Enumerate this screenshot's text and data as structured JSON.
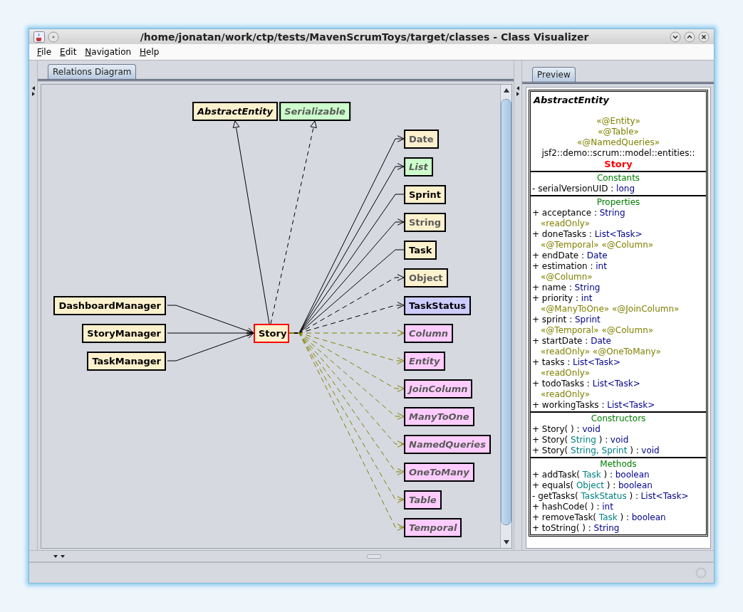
{
  "window": {
    "title": "/home/jonatan/work/ctp/tests/MavenScrumToys/target/classes - Class Visualizer"
  },
  "menu": [
    "File",
    "Edit",
    "Navigation",
    "Help"
  ],
  "diagram_tabs": [
    {
      "label": "Relations Diagram",
      "selected": true
    }
  ],
  "preview_tabs": [
    {
      "label": "Preview",
      "selected": true
    }
  ],
  "diagram": {
    "center": {
      "name": "Story",
      "kind": "class",
      "selected": true,
      "external": false
    },
    "supertypes": [
      {
        "name": "AbstractEntity",
        "kind": "abstract",
        "external": false,
        "edge": {
          "kind": "extends"
        }
      },
      {
        "name": "Serializable",
        "kind": "interface",
        "external": true,
        "edge": {
          "kind": "implements"
        }
      }
    ],
    "callers": [
      {
        "name": "DashboardManager",
        "kind": "class",
        "external": false,
        "edge": {
          "kind": "navigable"
        }
      },
      {
        "name": "StoryManager",
        "kind": "class",
        "external": false,
        "edge": {
          "kind": "navigable"
        }
      },
      {
        "name": "TaskManager",
        "kind": "class",
        "external": false,
        "edge": {
          "kind": "navigable"
        }
      }
    ],
    "dependencies": [
      {
        "name": "Date",
        "kind": "class",
        "external": true,
        "edge": {
          "kind": "navigable"
        }
      },
      {
        "name": "List",
        "kind": "interface",
        "external": true,
        "edge": {
          "kind": "navigable"
        }
      },
      {
        "name": "Sprint",
        "kind": "class",
        "external": false,
        "edge": {
          "kind": "association"
        }
      },
      {
        "name": "String",
        "kind": "class",
        "external": true,
        "edge": {
          "kind": "navigable"
        }
      },
      {
        "name": "Task",
        "kind": "class",
        "external": false,
        "edge": {
          "kind": "association"
        }
      },
      {
        "name": "Object",
        "kind": "class",
        "external": true,
        "edge": {
          "kind": "dependency"
        }
      },
      {
        "name": "TaskStatus",
        "kind": "enum",
        "external": false,
        "edge": {
          "kind": "dependency"
        }
      },
      {
        "name": "Column",
        "kind": "annotation",
        "external": true,
        "edge": {
          "kind": "annotation"
        }
      },
      {
        "name": "Entity",
        "kind": "annotation",
        "external": true,
        "edge": {
          "kind": "annotation"
        }
      },
      {
        "name": "JoinColumn",
        "kind": "annotation",
        "external": true,
        "edge": {
          "kind": "annotation"
        }
      },
      {
        "name": "ManyToOne",
        "kind": "annotation",
        "external": true,
        "edge": {
          "kind": "annotation"
        }
      },
      {
        "name": "NamedQueries",
        "kind": "annotation",
        "external": true,
        "edge": {
          "kind": "annotation"
        }
      },
      {
        "name": "OneToMany",
        "kind": "annotation",
        "external": true,
        "edge": {
          "kind": "annotation"
        }
      },
      {
        "name": "Table",
        "kind": "annotation",
        "external": true,
        "edge": {
          "kind": "annotation"
        }
      },
      {
        "name": "Temporal",
        "kind": "annotation",
        "external": true,
        "edge": {
          "kind": "annotation"
        }
      }
    ]
  },
  "preview": {
    "superclass": "AbstractEntity",
    "stereotypes": [
      "«@Entity»",
      "«@Table»",
      "«@NamedQueries»"
    ],
    "package": "jsf2::demo::scrum::model::entities::",
    "class_name": "Story",
    "constants_title": "Constants",
    "constants": [
      {
        "signature": "- serialVersionUID :",
        "type": "long"
      }
    ],
    "properties_title": "Properties",
    "properties": [
      {
        "signature": "+ acceptance :",
        "type": "String",
        "annotations": "«readOnly»"
      },
      {
        "signature": "+ doneTasks :",
        "type": "List<Task>",
        "annotations": "«@Temporal» «@Column»"
      },
      {
        "signature": "+ endDate :",
        "type": "Date"
      },
      {
        "signature": "+ estimation :",
        "type": "int",
        "annotations": "«@Column»"
      },
      {
        "signature": "+ name :",
        "type": "String"
      },
      {
        "signature": "+ priority :",
        "type": "int",
        "annotations": "«@ManyToOne» «@JoinColumn»"
      },
      {
        "signature": "+ sprint :",
        "type": "Sprint",
        "annotations": "«@Temporal» «@Column»"
      },
      {
        "signature": "+ startDate :",
        "type": "Date",
        "annotations": "«readOnly» «@OneToMany»"
      },
      {
        "signature": "+ tasks :",
        "type": "List<Task>",
        "annotations": "«readOnly»"
      },
      {
        "signature": "+ todoTasks :",
        "type": "List<Task>",
        "annotations": "«readOnly»"
      },
      {
        "signature": "+ workingTasks :",
        "type": "List<Task>"
      }
    ],
    "constructors_title": "Constructors",
    "constructors": [
      {
        "signature": "+ Story( ) :",
        "type": "void"
      },
      {
        "signature": "+ Story(",
        "params": "String",
        "tail": ") :",
        "type": "void"
      },
      {
        "signature": "+ Story(",
        "params": "String, Sprint",
        "tail": ") :",
        "type": "void"
      }
    ],
    "methods_title": "Methods",
    "methods": [
      {
        "signature": "+ addTask(",
        "params": "Task",
        "tail": ") :",
        "type": "boolean"
      },
      {
        "signature": "+ equals(",
        "params": "Object",
        "tail": ") :",
        "type": "boolean"
      },
      {
        "signature": "- getTasks(",
        "params": "TaskStatus",
        "tail": ") :",
        "type": "List<Task>"
      },
      {
        "signature": "+ hashCode( ) :",
        "type": "int"
      },
      {
        "signature": "+ removeTask(",
        "params": "Task",
        "tail": ") :",
        "type": "boolean"
      },
      {
        "signature": "+ toString( ) :",
        "type": "String"
      }
    ]
  }
}
